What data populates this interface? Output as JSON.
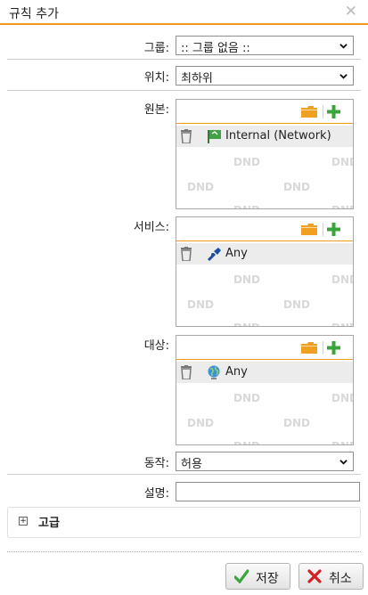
{
  "dialog": {
    "title": "규칙 추가",
    "close_glyph": "✕"
  },
  "form": {
    "group": {
      "label": "그룹:",
      "value": ":: 그룹 없음 ::"
    },
    "position": {
      "label": "위치:",
      "value": "최하위"
    },
    "source": {
      "label": "원본:",
      "items": [
        {
          "icon": "network-flag-icon",
          "text": "Internal (Network)"
        }
      ]
    },
    "service": {
      "label": "서비스:",
      "items": [
        {
          "icon": "service-plug-icon",
          "text": "Any"
        }
      ]
    },
    "destination": {
      "label": "대상:",
      "items": [
        {
          "icon": "globe-icon",
          "text": "Any"
        }
      ]
    },
    "action": {
      "label": "동작:",
      "value": "허용"
    },
    "description": {
      "label": "설명:",
      "value": ""
    }
  },
  "dnd_watermark": "DND",
  "advanced": {
    "label": "고급",
    "toggle_glyph": "+"
  },
  "buttons": {
    "save": "저장",
    "cancel": "취소"
  },
  "colors": {
    "accent": "#f39a1c",
    "add_green": "#3aa53a",
    "folder_orange": "#f0a020",
    "cancel_red": "#d42020"
  }
}
